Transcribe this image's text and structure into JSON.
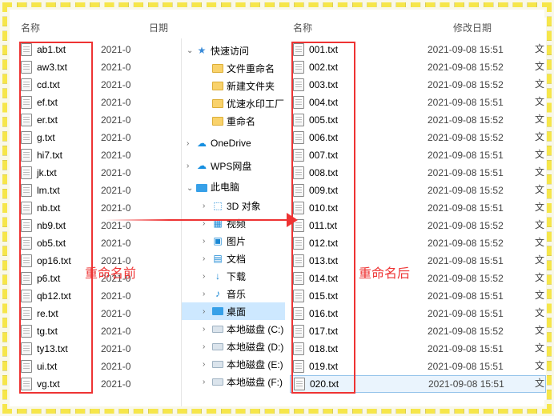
{
  "left": {
    "header_name": "名称",
    "header_date": "日期",
    "date_clip": "2021-0",
    "files": [
      "ab1.txt",
      "aw3.txt",
      "cd.txt",
      "ef.txt",
      "er.txt",
      "g.txt",
      "hi7.txt",
      "jk.txt",
      "lm.txt",
      "nb.txt",
      "nb9.txt",
      "ob5.txt",
      "op16.txt",
      "p6.txt",
      "qb12.txt",
      "re.txt",
      "tg.txt",
      "ty13.txt",
      "ui.txt",
      "vg.txt"
    ]
  },
  "labels": {
    "before": "重命名前",
    "after": "重命名后"
  },
  "tree": {
    "items": [
      {
        "chev": "v",
        "icon": "star",
        "label": "快速访问",
        "indent": false,
        "sel": false,
        "name": "quick-access"
      },
      {
        "chev": "",
        "icon": "folder",
        "label": "文件重命名",
        "indent": true,
        "sel": false,
        "name": "folder-rename"
      },
      {
        "chev": "",
        "icon": "folder",
        "label": "新建文件夹",
        "indent": true,
        "sel": false,
        "name": "folder-new"
      },
      {
        "chev": "",
        "icon": "folder",
        "label": "优速水印工厂",
        "indent": true,
        "sel": false,
        "name": "folder-watermark"
      },
      {
        "chev": "",
        "icon": "folder",
        "label": "重命名",
        "indent": true,
        "sel": false,
        "name": "folder-rename2"
      },
      {
        "chev": ">",
        "icon": "cloud",
        "label": "OneDrive",
        "indent": false,
        "sel": false,
        "name": "onedrive"
      },
      {
        "chev": ">",
        "icon": "cloud",
        "label": "WPS网盘",
        "indent": false,
        "sel": false,
        "name": "wps-cloud"
      },
      {
        "chev": "v",
        "icon": "monitor",
        "label": "此电脑",
        "indent": false,
        "sel": false,
        "name": "this-pc",
        "clip": true
      },
      {
        "chev": ">",
        "icon": "3d",
        "label": "3D 对象",
        "indent": true,
        "sel": false,
        "name": "3d-objects"
      },
      {
        "chev": ">",
        "icon": "vid",
        "label": "视频",
        "indent": true,
        "sel": false,
        "name": "videos"
      },
      {
        "chev": ">",
        "icon": "pic",
        "label": "图片",
        "indent": true,
        "sel": false,
        "name": "pictures"
      },
      {
        "chev": ">",
        "icon": "doc",
        "label": "文档",
        "indent": true,
        "sel": false,
        "name": "documents"
      },
      {
        "chev": ">",
        "icon": "dl",
        "label": "下载",
        "indent": true,
        "sel": false,
        "name": "downloads"
      },
      {
        "chev": ">",
        "icon": "music",
        "label": "音乐",
        "indent": true,
        "sel": false,
        "name": "music"
      },
      {
        "chev": ">",
        "icon": "desk",
        "label": "桌面",
        "indent": true,
        "sel": true,
        "name": "desktop"
      },
      {
        "chev": ">",
        "icon": "drive",
        "label": "本地磁盘 (C:)",
        "indent": true,
        "sel": false,
        "name": "drive-c"
      },
      {
        "chev": ">",
        "icon": "drive",
        "label": "本地磁盘 (D:)",
        "indent": true,
        "sel": false,
        "name": "drive-d"
      },
      {
        "chev": ">",
        "icon": "drive",
        "label": "本地磁盘 (E:)",
        "indent": true,
        "sel": false,
        "name": "drive-e"
      },
      {
        "chev": ">",
        "icon": "drive",
        "label": "本地磁盘 (F:)",
        "indent": true,
        "sel": false,
        "name": "drive-f"
      }
    ]
  },
  "right": {
    "header_name": "名称",
    "header_date": "修改日期",
    "rows": [
      {
        "n": "001.txt",
        "d": "2021-09-08 15:51"
      },
      {
        "n": "002.txt",
        "d": "2021-09-08 15:52"
      },
      {
        "n": "003.txt",
        "d": "2021-09-08 15:52"
      },
      {
        "n": "004.txt",
        "d": "2021-09-08 15:51"
      },
      {
        "n": "005.txt",
        "d": "2021-09-08 15:52"
      },
      {
        "n": "006.txt",
        "d": "2021-09-08 15:52"
      },
      {
        "n": "007.txt",
        "d": "2021-09-08 15:51"
      },
      {
        "n": "008.txt",
        "d": "2021-09-08 15:51"
      },
      {
        "n": "009.txt",
        "d": "2021-09-08 15:52"
      },
      {
        "n": "010.txt",
        "d": "2021-09-08 15:51"
      },
      {
        "n": "011.txt",
        "d": "2021-09-08 15:52"
      },
      {
        "n": "012.txt",
        "d": "2021-09-08 15:52"
      },
      {
        "n": "013.txt",
        "d": "2021-09-08 15:51"
      },
      {
        "n": "014.txt",
        "d": "2021-09-08 15:52"
      },
      {
        "n": "015.txt",
        "d": "2021-09-08 15:51"
      },
      {
        "n": "016.txt",
        "d": "2021-09-08 15:51"
      },
      {
        "n": "017.txt",
        "d": "2021-09-08 15:52"
      },
      {
        "n": "018.txt",
        "d": "2021-09-08 15:51"
      },
      {
        "n": "019.txt",
        "d": "2021-09-08 15:51"
      },
      {
        "n": "020.txt",
        "d": "2021-09-08 15:51",
        "sel": true
      }
    ],
    "clip_char": "文"
  }
}
